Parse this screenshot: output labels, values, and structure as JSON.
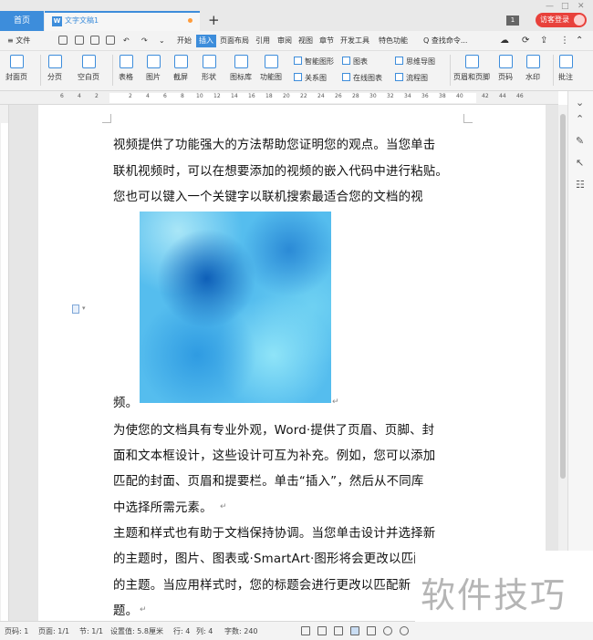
{
  "titlebar": {
    "home_tab": "首页",
    "doc_tab": "文字文稿1",
    "add_tab": "+",
    "page_badge": "1",
    "login": "访客登录"
  },
  "menubar": {
    "file": "≡ 文件",
    "items": [
      "开始",
      "插入",
      "页面布局",
      "引用",
      "审阅",
      "视图",
      "章节",
      "开发工具",
      "特色功能"
    ],
    "active": "插入",
    "search": "Q 查找命令..."
  },
  "ribbon": {
    "big": [
      "封面页",
      "分页",
      "空白页",
      "表格",
      "图片",
      "截屏",
      "形状",
      "图标库",
      "功能图",
      "页眉和页脚",
      "页码",
      "水印",
      "批注"
    ],
    "small": [
      "智能图形",
      "关系图",
      "图表",
      "在线图表",
      "思维导图",
      "流程图"
    ]
  },
  "ruler_numbers": [
    "6",
    "4",
    "2",
    "2",
    "4",
    "6",
    "8",
    "10",
    "12",
    "14",
    "16",
    "18",
    "20",
    "22",
    "24",
    "26",
    "28",
    "30",
    "32",
    "34",
    "36",
    "38",
    "40",
    "42",
    "44",
    "46"
  ],
  "document": {
    "lines": [
      "视频提供了功能强大的方法帮助您证明您的观点。当您单击",
      "联机视频时，可以在想要添加的视频的嵌入代码中进行粘贴。",
      "您也可以键入一个关键字以联机搜索最适合您的文档的视",
      "频。",
      "为使您的文档具有专业外观，Word·提供了页眉、页脚、封",
      "面和文本框设计，这些设计可互为补充。例如，您可以添加",
      "匹配的封面、页眉和提要栏。单击“插入”，然后从不同库",
      "中选择所需元素。",
      "主题和样式也有助于文档保持协调。当您单击设计并选择新",
      "的主题时，图片、图表或·SmartArt·图形将会更改以匹配新",
      "的主题。当应用样式时，您的标题会进行更改以匹配新",
      "题。"
    ]
  },
  "status": {
    "page_no": "页码: 1",
    "pages": "页面: 1/1",
    "section": "节: 1/1",
    "setting": "设置值: 5.8厘米",
    "row": "行: 4",
    "col": "列: 4",
    "words": "字数: 240"
  },
  "watermark": "软件技巧",
  "colors": {
    "accent": "#3d8ddb",
    "login": "#e8413b"
  }
}
